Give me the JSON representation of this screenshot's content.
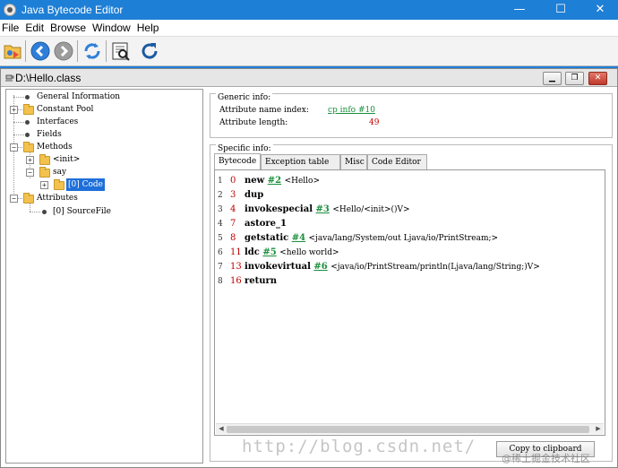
{
  "window": {
    "title": "Java Bytecode Editor",
    "controls": {
      "minimize": "—",
      "maximize": "☐",
      "close": "✕"
    }
  },
  "menu": [
    "File",
    "Edit",
    "Browse",
    "Window",
    "Help"
  ],
  "toolbar": {
    "buttons": [
      "open-icon",
      "back-icon",
      "forward-icon",
      "refresh-icon",
      "inspect-icon",
      "reload-icon"
    ]
  },
  "internal_frame": {
    "title": "D:\\Hello.class",
    "controls": {
      "minimize": "▁",
      "restore": "❐",
      "close": "✕"
    }
  },
  "tree": {
    "general_information": "General Information",
    "constant_pool": "Constant Pool",
    "interfaces": "Interfaces",
    "fields": "Fields",
    "methods": "Methods",
    "init": "<init>",
    "say": "say",
    "code": "[0] Code",
    "attributes": "Attributes",
    "sourcefile": "[0] SourceFile"
  },
  "generic_info": {
    "title": "Generic info:",
    "name_index_label": "Attribute name index:",
    "name_index_value": "cp info #10",
    "length_label": "Attribute length:",
    "length_value": "49"
  },
  "specific_info": {
    "title": "Specific info:",
    "tabs": [
      "Bytecode",
      "Exception table",
      "Misc",
      "Code Editor"
    ],
    "active_tab": "Bytecode"
  },
  "bytecode": [
    {
      "line": "1",
      "offset": "0",
      "instr": "new",
      "ref": "#2",
      "arg": "<Hello>"
    },
    {
      "line": "2",
      "offset": "3",
      "instr": "dup",
      "ref": "",
      "arg": ""
    },
    {
      "line": "3",
      "offset": "4",
      "instr": "invokespecial",
      "ref": "#3",
      "arg": "<Hello/<init>()V>"
    },
    {
      "line": "4",
      "offset": "7",
      "instr": "astore_1",
      "ref": "",
      "arg": ""
    },
    {
      "line": "5",
      "offset": "8",
      "instr": "getstatic",
      "ref": "#4",
      "arg": "<java/lang/System/out Ljava/io/PrintStream;>"
    },
    {
      "line": "6",
      "offset": "11",
      "instr": "ldc",
      "ref": "#5",
      "arg": "<hello world>"
    },
    {
      "line": "7",
      "offset": "13",
      "instr": "invokevirtual",
      "ref": "#6",
      "arg": "<java/io/PrintStream/println(Ljava/lang/String;)V>"
    },
    {
      "line": "8",
      "offset": "16",
      "instr": "return",
      "ref": "",
      "arg": ""
    }
  ],
  "copy_button": "Copy to clipboard",
  "watermark": "http://blog.csdn.net/",
  "watermark_site": "@稀土掘金技术社区"
}
